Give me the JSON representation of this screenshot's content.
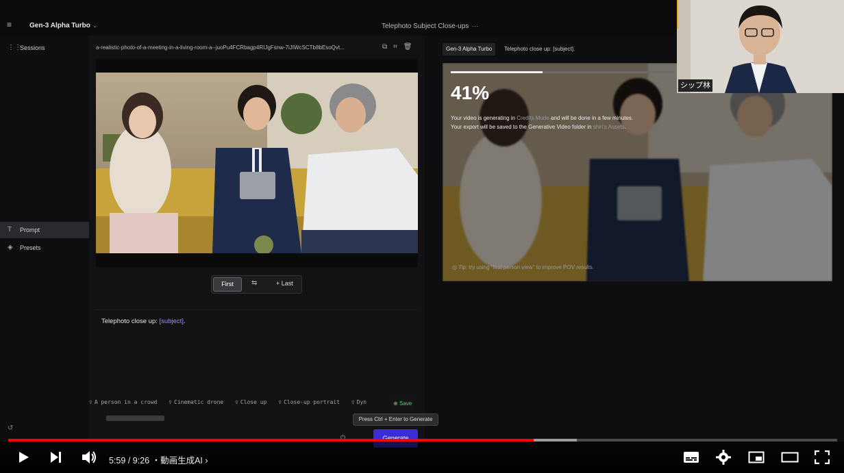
{
  "app": {
    "menu_icon": "hamburger-icon",
    "model_title": "Gen-3 Alpha Turbo",
    "session_title": "Telephoto Subject Close-ups",
    "session_more": "···"
  },
  "sidebar": {
    "items": [
      {
        "icon": "sessions-icon",
        "label": "Sessions"
      },
      {
        "icon": "text-icon",
        "label": "Prompt"
      },
      {
        "icon": "layers-icon",
        "label": "Presets"
      }
    ],
    "bottom_icon": "undo-icon"
  },
  "editor": {
    "filename": "a-realistic-photo-of-a-meeting-in-a-living-room-a--juoPu4FCRbagp4RIJgFsnw-7iJIWcSCTb8bEsoQvt...",
    "frame_first": "First",
    "frame_swap": "⇆",
    "frame_last": "+ Last",
    "prompt_prefix": "Telephoto close up: ",
    "prompt_tag": "[subject]",
    "prompt_suffix": ".",
    "presets": [
      "A person in a crowd",
      "Cinematic drone",
      "Close up",
      "Close-up portrait",
      "Dyn"
    ],
    "save_label": "Save",
    "tooltip": "Press Ctrl + Enter to Generate",
    "generate_label": "Generate"
  },
  "output": {
    "model_chip": "Gen-3 Alpha Turbo",
    "prompt": "Telephoto close up: [subject].",
    "progress_percent": 41,
    "progress_label": "41%",
    "msg_line1_a": "Your video is generating in ",
    "msg_line1_hl": "Credits Mode",
    "msg_line1_b": " and will be done in a few minutes.",
    "msg_line2_a": "Your export will be saved to the Generative Video folder in ",
    "msg_line2_hl": "shiri's Assets",
    "msg_line2_b": ".",
    "tip": "Tip: try using \"first person view\" to improve POV results."
  },
  "pip": {
    "name_label": "シップ林"
  },
  "player": {
    "current_time": "5:59",
    "duration": "9:26",
    "chapter": "・動画生成AI",
    "played_fraction": 0.634,
    "buffered_fraction": 0.686
  }
}
